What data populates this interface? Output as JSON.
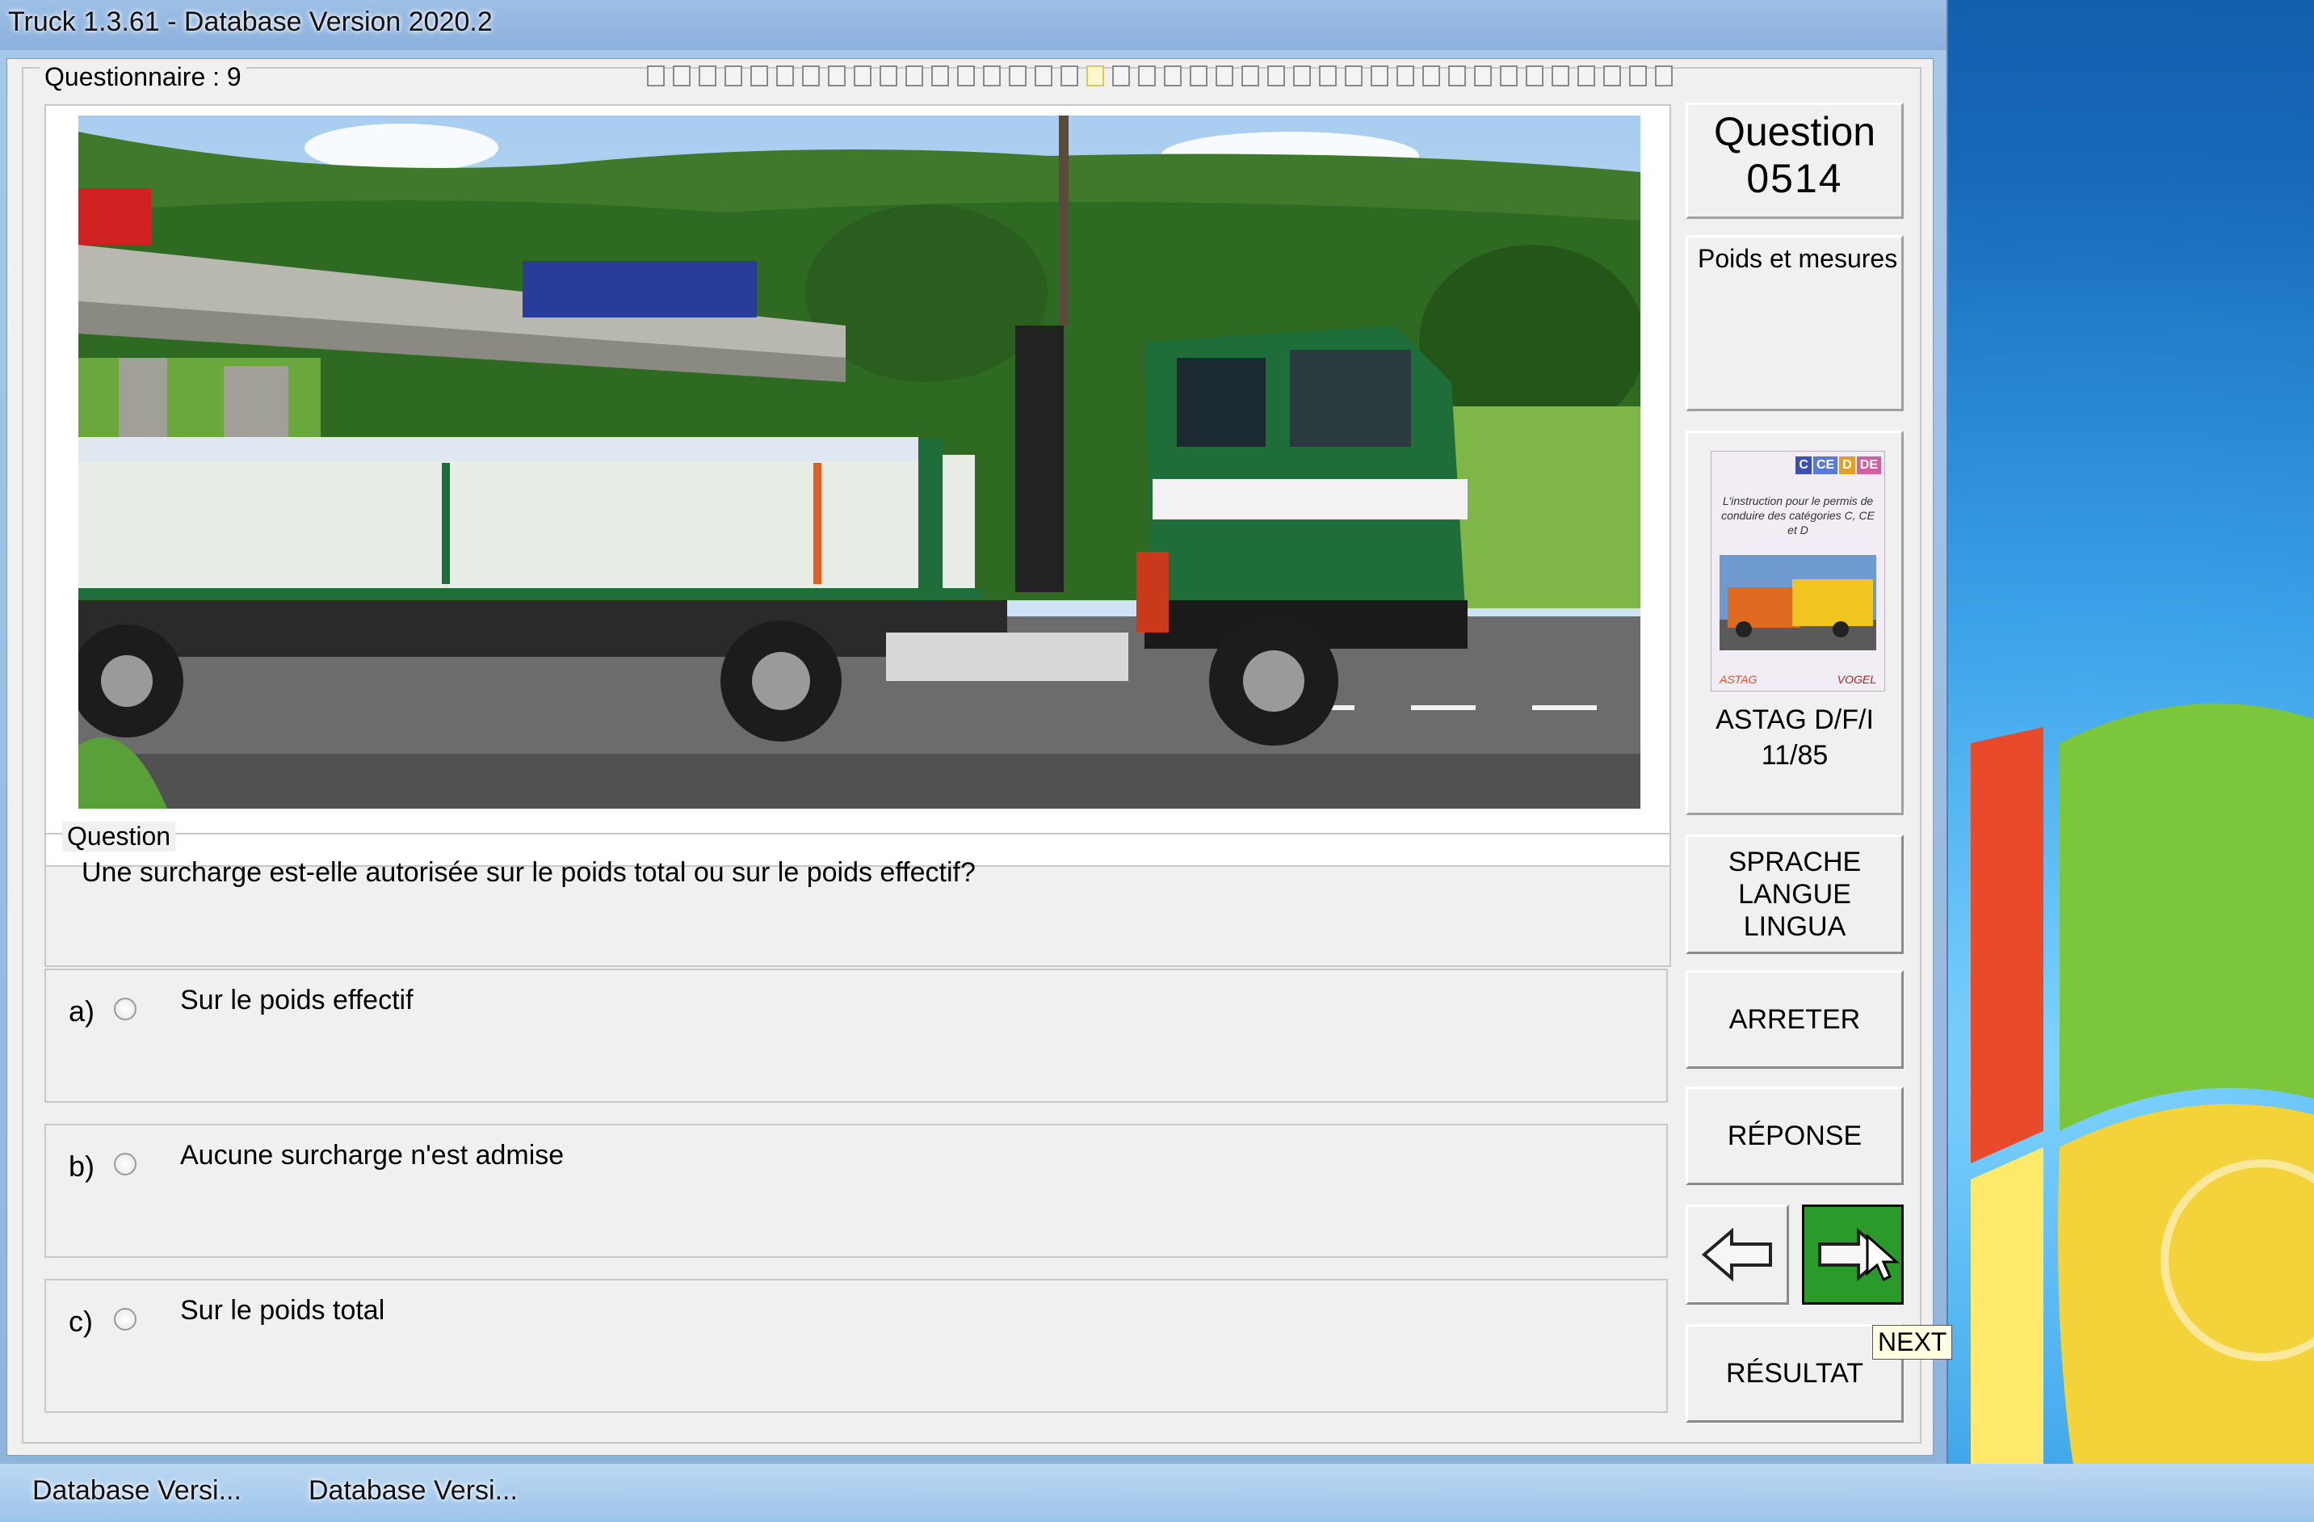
{
  "window": {
    "title": "Truck 1.3.61 - Database Version 2020.2"
  },
  "questionnaire": {
    "label": "Questionnaire : 9",
    "cells": 40,
    "active_cell": 17
  },
  "question_number": {
    "line1": "Question",
    "line2": "0514"
  },
  "category": "Poids et mesures",
  "book": {
    "badges": [
      {
        "text": "C",
        "color": "#3a4fb8"
      },
      {
        "text": "CE",
        "color": "#5a7ad8"
      },
      {
        "text": "D",
        "color": "#e0a020"
      },
      {
        "text": "DE",
        "color": "#d060a0"
      }
    ],
    "cover_title": "L'instruction pour le permis de conduire des catégories C, CE et D",
    "publisher_left": "ASTAG",
    "publisher_right": "VOGEL",
    "label_line1": "ASTAG D/F/I",
    "label_line2": "11/85"
  },
  "question": {
    "legend": "Question",
    "text": "Une surcharge est-elle autorisée sur le poids total ou sur le poids effectif?"
  },
  "answers": [
    {
      "letter": "a)",
      "text": "Sur le poids effectif"
    },
    {
      "letter": "b)",
      "text": "Aucune surcharge n'est admise"
    },
    {
      "letter": "c)",
      "text": "Sur le poids total"
    }
  ],
  "buttons": {
    "language": "SPRACHE\nLANGUE\nLINGUA",
    "stop": "ARRETER",
    "answer": "RÉPONSE",
    "result": "RÉSULTAT"
  },
  "tooltip": "NEXT",
  "taskbar": [
    "Database Versi...",
    "Database Versi..."
  ],
  "colors": {
    "next_button": "#2a9a2a",
    "truck_cab": "#1f6e3a"
  },
  "icons": [
    "arrow-left-icon",
    "arrow-right-icon",
    "cursor-icon"
  ]
}
